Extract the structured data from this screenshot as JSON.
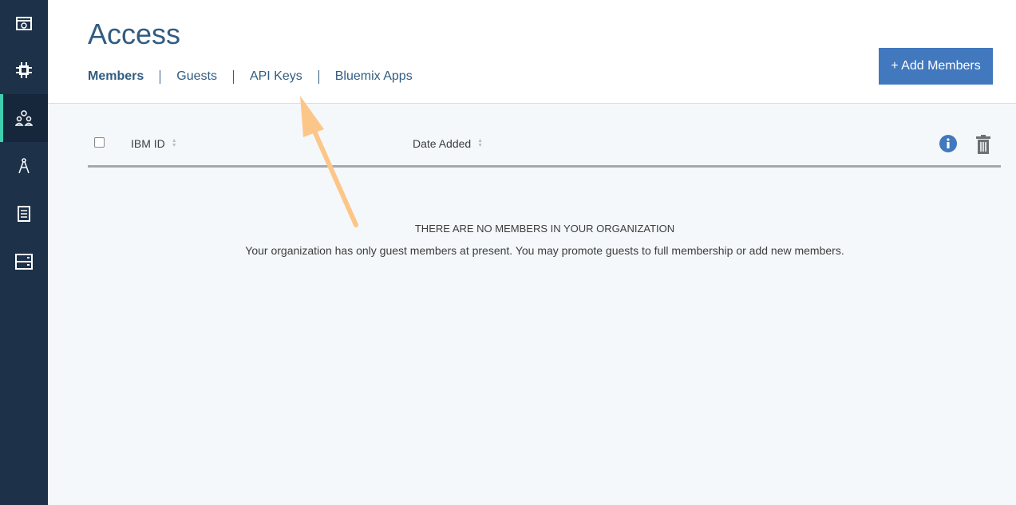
{
  "sidebar": {
    "items": [
      {
        "icon": "dashboard-icon",
        "active": false
      },
      {
        "icon": "chip-icon",
        "active": false
      },
      {
        "icon": "users-icon",
        "active": true
      },
      {
        "icon": "compass-icon",
        "active": false
      },
      {
        "icon": "document-icon",
        "active": false
      },
      {
        "icon": "storage-icon",
        "active": false
      }
    ]
  },
  "header": {
    "title": "Access",
    "tabs": [
      {
        "label": "Members",
        "active": true
      },
      {
        "label": "Guests",
        "active": false
      },
      {
        "label": "API Keys",
        "active": false
      },
      {
        "label": "Bluemix Apps",
        "active": false
      }
    ],
    "add_button": "+ Add Members"
  },
  "table": {
    "columns": [
      "IBM ID",
      "Date Added"
    ]
  },
  "empty_state": {
    "title": "THERE ARE NO MEMBERS IN YOUR ORGANIZATION",
    "description": "Your organization has only guest members at present. You may promote guests to full membership or add new members."
  },
  "colors": {
    "sidebar": "#1d3149",
    "accent": "#3ecfb0",
    "primary": "#4178be",
    "title": "#325c80",
    "annotation_arrow": "#fdc689"
  }
}
